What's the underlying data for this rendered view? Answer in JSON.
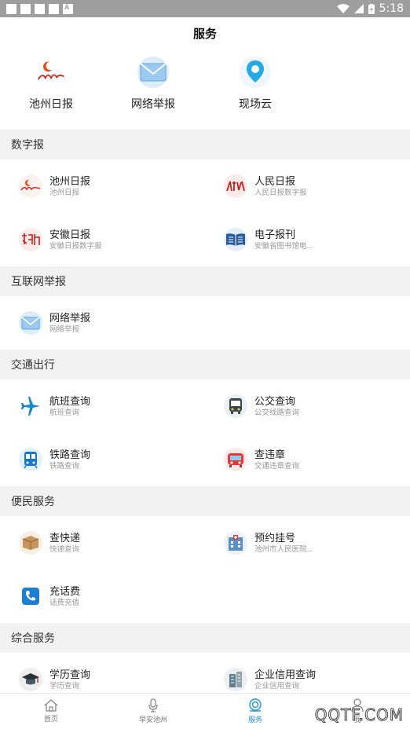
{
  "status_bar": {
    "time": "5:18",
    "battery_icon": "battery-charging-icon",
    "wifi_icon": "wifi-icon",
    "signal_icon": "signal-icon"
  },
  "header": {
    "title": "服务"
  },
  "quick": [
    {
      "label": "池州日报",
      "icon": "chizhou-daily-logo"
    },
    {
      "label": "网络举报",
      "icon": "envelope-icon"
    },
    {
      "label": "现场云",
      "icon": "location-pin-icon"
    }
  ],
  "sections": {
    "digital": {
      "title": "数字报",
      "items": [
        {
          "title": "池州日报",
          "subtitle": "池州日报",
          "icon": "chizhou-daily-logo"
        },
        {
          "title": "人民日报",
          "subtitle": "人民日报数字报",
          "icon": "peoples-daily-logo"
        },
        {
          "title": "安徽日报",
          "subtitle": "安徽日报数字报",
          "icon": "anhui-daily-logo"
        },
        {
          "title": "电子报刊",
          "subtitle": "安徽省图书馆电...",
          "icon": "book-icon"
        }
      ]
    },
    "report": {
      "title": "互联网举报",
      "items": [
        {
          "title": "网络举报",
          "subtitle": "网络举报",
          "icon": "envelope-icon"
        }
      ]
    },
    "traffic": {
      "title": "交通出行",
      "items": [
        {
          "title": "航班查询",
          "subtitle": "航班查询",
          "icon": "airplane-icon"
        },
        {
          "title": "公交查询",
          "subtitle": "公交线路查询",
          "icon": "bus-icon"
        },
        {
          "title": "铁路查询",
          "subtitle": "铁路查询",
          "icon": "train-icon"
        },
        {
          "title": "查违章",
          "subtitle": "交通违章查询",
          "icon": "car-icon"
        }
      ]
    },
    "civic": {
      "title": "便民服务",
      "items": [
        {
          "title": "查快递",
          "subtitle": "快递查询",
          "icon": "package-icon"
        },
        {
          "title": "预约挂号",
          "subtitle": "池州市人民医院...",
          "icon": "hospital-icon"
        },
        {
          "title": "充话费",
          "subtitle": "话费充值",
          "icon": "phone-icon"
        }
      ]
    },
    "general": {
      "title": "综合服务",
      "items": [
        {
          "title": "学历查询",
          "subtitle": "学历查询",
          "icon": "graduation-cap-icon"
        },
        {
          "title": "企业信用查询",
          "subtitle": "企业信用查询",
          "icon": "building-icon"
        }
      ]
    }
  },
  "bottom_nav": [
    {
      "label": "首页",
      "icon": "home-icon",
      "active": false
    },
    {
      "label": "早安池州",
      "icon": "microphone-icon",
      "active": false
    },
    {
      "label": "服务",
      "icon": "search-service-icon",
      "active": true
    },
    {
      "label": "我",
      "icon": "user-icon",
      "active": false
    }
  ],
  "watermark": "QQTF.COM",
  "colors": {
    "accent": "#2196d6",
    "status_bar": "#9e9e9e",
    "background": "#f2f2f2"
  }
}
